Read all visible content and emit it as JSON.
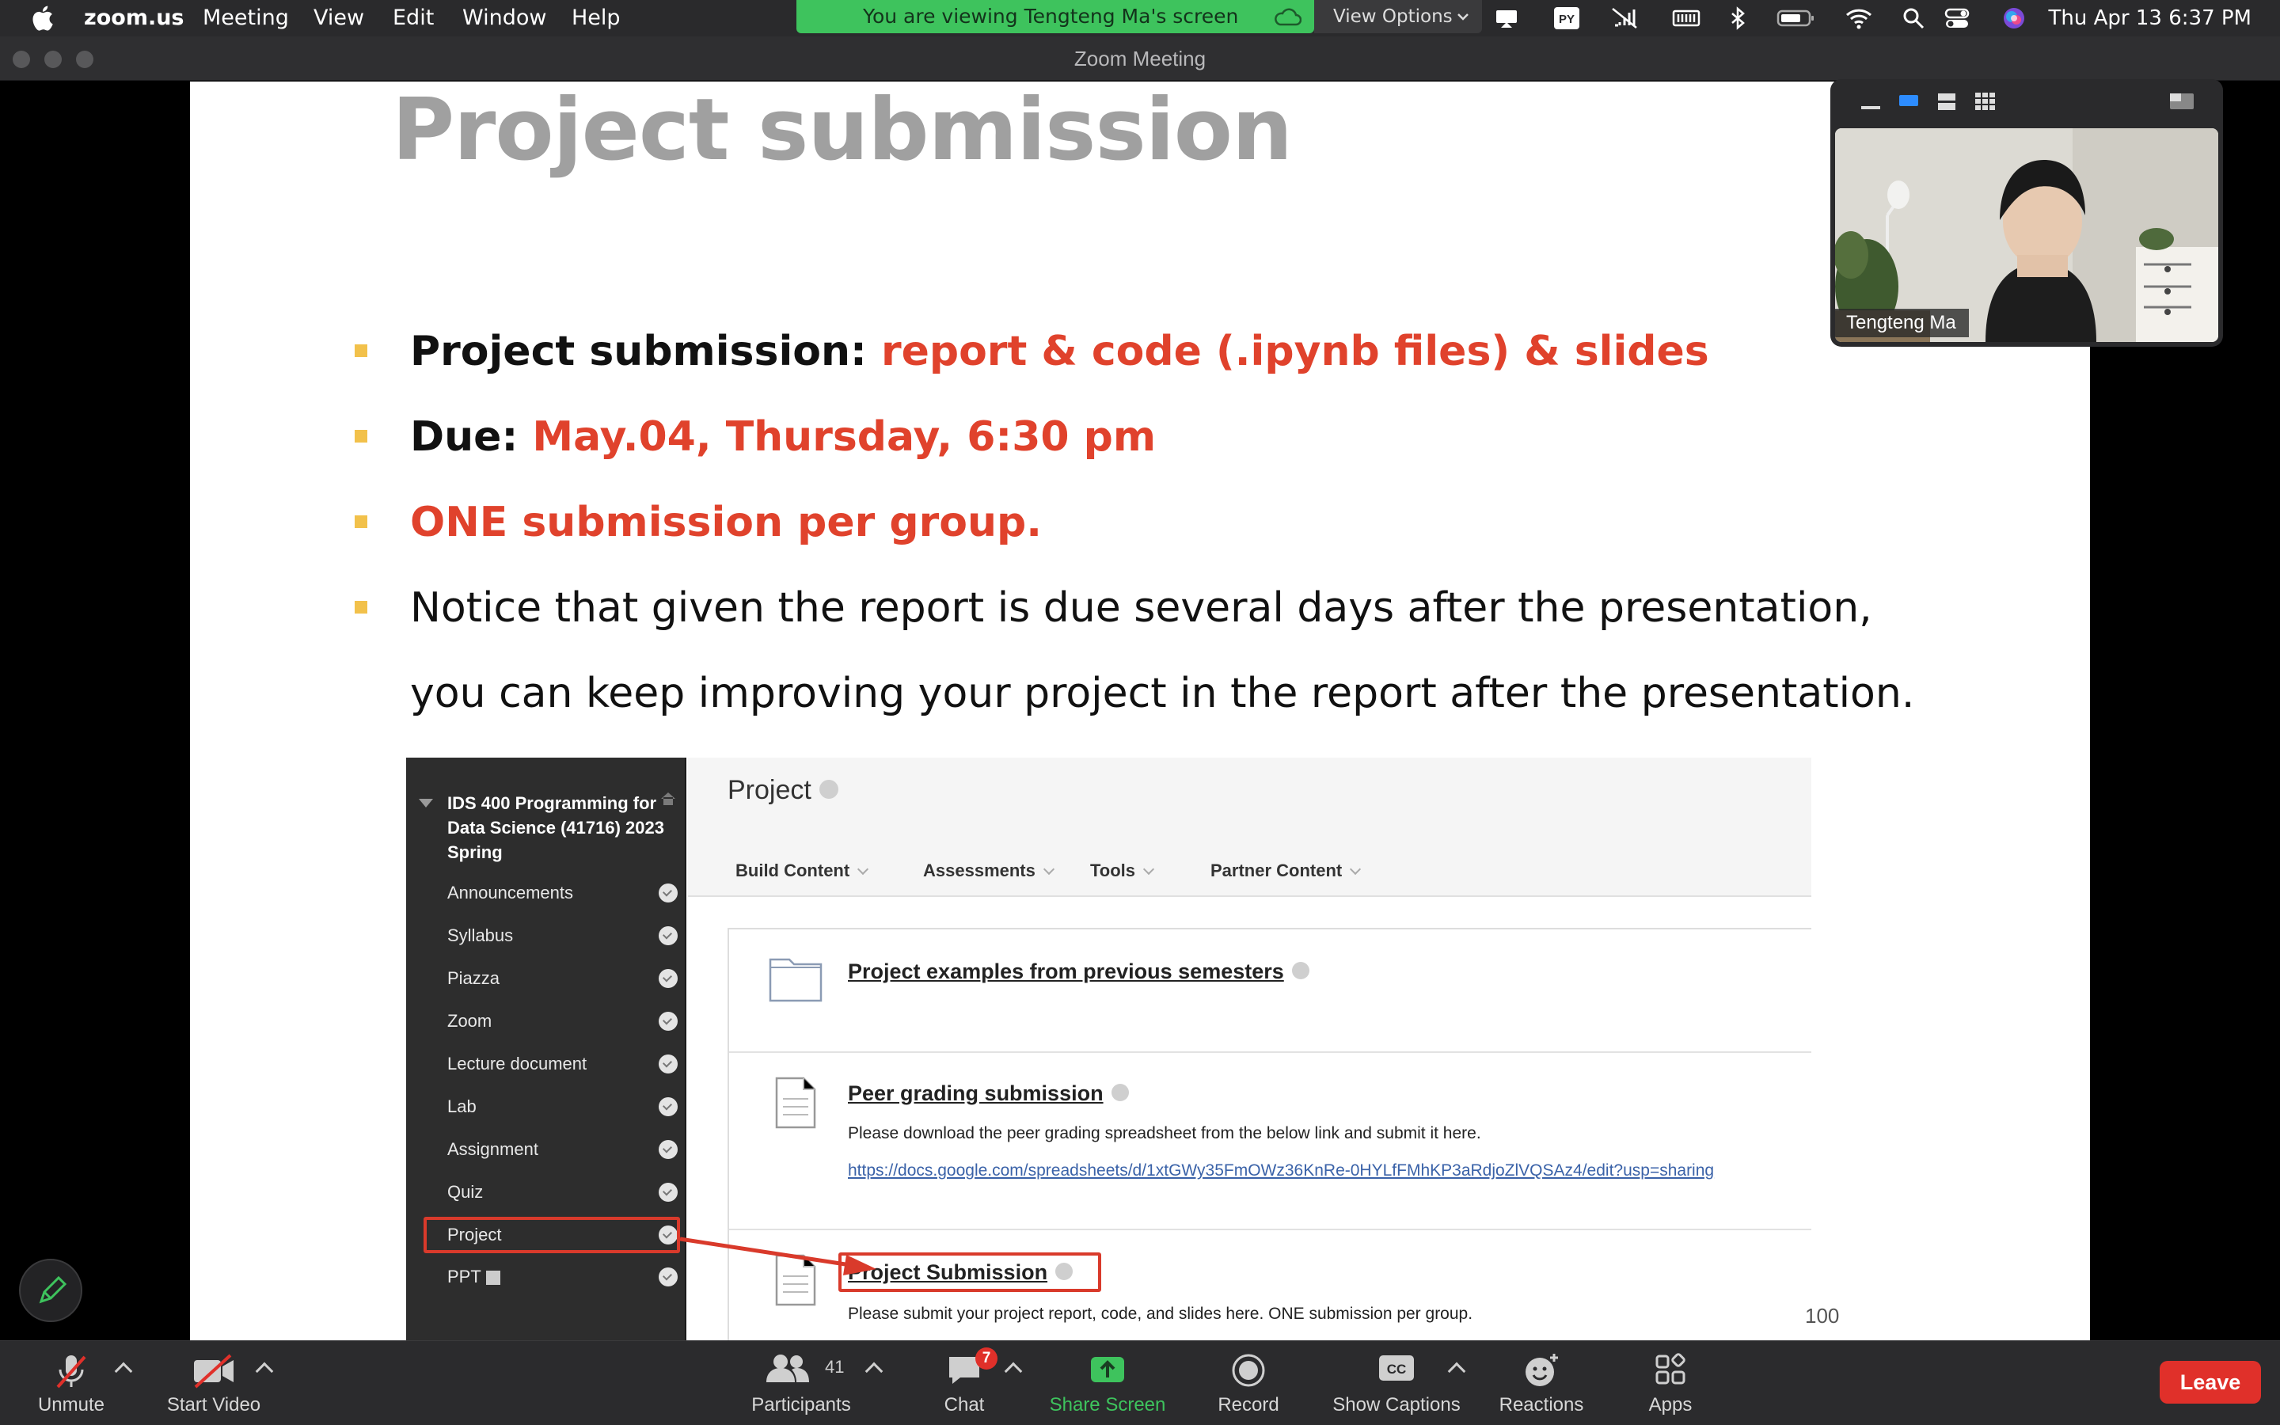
{
  "menubar": {
    "app": "zoom.us",
    "items": [
      "Meeting",
      "View",
      "Edit",
      "Window",
      "Help"
    ],
    "banner": "You are viewing Tengteng Ma's screen",
    "view_options": "View Options",
    "clock": "Thu Apr 13  6:37 PM"
  },
  "window": {
    "title": "Zoom Meeting"
  },
  "slide": {
    "title": "Project submission",
    "bullet1_label": "Project submission: ",
    "bullet1_value": "report & code (.ipynb files) & slides",
    "bullet2_label": "Due: ",
    "bullet2_value": "May.04, Thursday, 6:30 pm",
    "bullet3": "ONE submission per group.",
    "bullet4_line1": "Notice that given the report is due several days after the presentation,",
    "bullet4_line2": "you can keep improving your project in the report after the presentation.",
    "page_number": "100"
  },
  "blackboard": {
    "course": "IDS 400 Programming for Data Science (41716) 2023 Spring",
    "nav": [
      "Announcements",
      "Syllabus",
      "Piazza",
      "Zoom",
      "Lecture document",
      "Lab",
      "Assignment",
      "Quiz",
      "Project",
      "PPT"
    ],
    "page_title": "Project",
    "tabs": [
      "Build Content",
      "Assessments",
      "Tools",
      "Partner Content"
    ],
    "items": {
      "examples": "Project examples from previous semesters",
      "peer": "Peer grading submission",
      "peer_desc": "Please download the peer grading spreadsheet from the below link and submit it here.",
      "peer_url": "https://docs.google.com/spreadsheets/d/1xtGWy35FmOWz36KnRe-0HYLfFMhKP3aRdjoZlVQSAz4/edit?usp=sharing",
      "submission": "Project Submission",
      "submission_desc": "Please submit your project report, code, and slides here. ONE submission per group."
    }
  },
  "selfview": {
    "name": "Tengteng Ma"
  },
  "toolbar": {
    "unmute": "Unmute",
    "start_video": "Start Video",
    "participants": "Participants",
    "participants_count": "41",
    "chat": "Chat",
    "chat_badge": "7",
    "share": "Share Screen",
    "record": "Record",
    "captions": "Show Captions",
    "reactions": "Reactions",
    "apps": "Apps",
    "leave": "Leave"
  },
  "colors": {
    "accent_green": "#3ec35d",
    "leave_red": "#e0302a",
    "slide_red": "#e0422c",
    "bullet_gold": "#f2c14b"
  }
}
